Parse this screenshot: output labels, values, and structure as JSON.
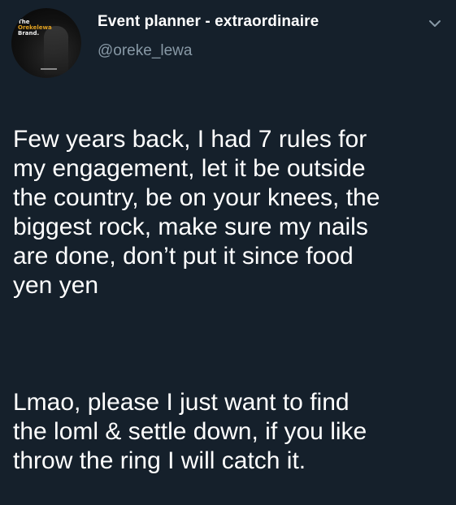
{
  "tweet": {
    "author": {
      "display_name": "Event planner - extraordinaire",
      "handle": "@oreke_lewa",
      "avatar_brand_line1": "The",
      "avatar_brand_line2": "Orekelewa",
      "avatar_brand_line3": "Brand."
    },
    "menu_icon": "chevron-down-icon",
    "paragraphs": [
      "Few years back, I had 7 rules for\nmy engagement, let it be outside\nthe country, be on your knees, the\nbiggest rock, make sure my nails\nare done, don’t put it since food\nyen yen",
      "Lmao, please I just want to find\nthe loml & settle down, if you like\nthrow the ring I will catch it."
    ]
  },
  "colors": {
    "background": "#15202b",
    "text_primary": "#ffffff",
    "text_secondary": "#8899a6"
  }
}
